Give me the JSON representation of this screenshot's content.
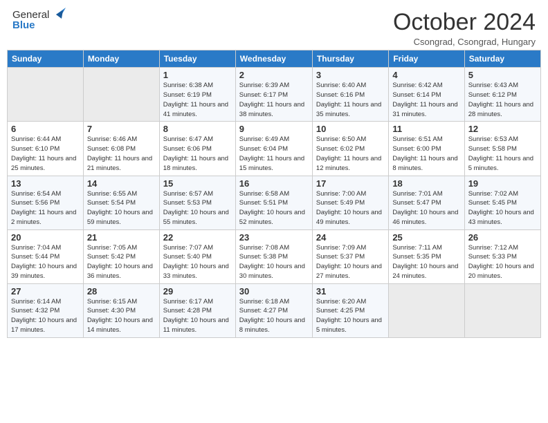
{
  "header": {
    "logo_general": "General",
    "logo_blue": "Blue",
    "month_title": "October 2024",
    "location": "Csongrad, Csongrad, Hungary"
  },
  "days_of_week": [
    "Sunday",
    "Monday",
    "Tuesday",
    "Wednesday",
    "Thursday",
    "Friday",
    "Saturday"
  ],
  "weeks": [
    [
      {
        "day": "",
        "info": ""
      },
      {
        "day": "",
        "info": ""
      },
      {
        "day": "1",
        "info": "Sunrise: 6:38 AM\nSunset: 6:19 PM\nDaylight: 11 hours and 41 minutes."
      },
      {
        "day": "2",
        "info": "Sunrise: 6:39 AM\nSunset: 6:17 PM\nDaylight: 11 hours and 38 minutes."
      },
      {
        "day": "3",
        "info": "Sunrise: 6:40 AM\nSunset: 6:16 PM\nDaylight: 11 hours and 35 minutes."
      },
      {
        "day": "4",
        "info": "Sunrise: 6:42 AM\nSunset: 6:14 PM\nDaylight: 11 hours and 31 minutes."
      },
      {
        "day": "5",
        "info": "Sunrise: 6:43 AM\nSunset: 6:12 PM\nDaylight: 11 hours and 28 minutes."
      }
    ],
    [
      {
        "day": "6",
        "info": "Sunrise: 6:44 AM\nSunset: 6:10 PM\nDaylight: 11 hours and 25 minutes."
      },
      {
        "day": "7",
        "info": "Sunrise: 6:46 AM\nSunset: 6:08 PM\nDaylight: 11 hours and 21 minutes."
      },
      {
        "day": "8",
        "info": "Sunrise: 6:47 AM\nSunset: 6:06 PM\nDaylight: 11 hours and 18 minutes."
      },
      {
        "day": "9",
        "info": "Sunrise: 6:49 AM\nSunset: 6:04 PM\nDaylight: 11 hours and 15 minutes."
      },
      {
        "day": "10",
        "info": "Sunrise: 6:50 AM\nSunset: 6:02 PM\nDaylight: 11 hours and 12 minutes."
      },
      {
        "day": "11",
        "info": "Sunrise: 6:51 AM\nSunset: 6:00 PM\nDaylight: 11 hours and 8 minutes."
      },
      {
        "day": "12",
        "info": "Sunrise: 6:53 AM\nSunset: 5:58 PM\nDaylight: 11 hours and 5 minutes."
      }
    ],
    [
      {
        "day": "13",
        "info": "Sunrise: 6:54 AM\nSunset: 5:56 PM\nDaylight: 11 hours and 2 minutes."
      },
      {
        "day": "14",
        "info": "Sunrise: 6:55 AM\nSunset: 5:54 PM\nDaylight: 10 hours and 59 minutes."
      },
      {
        "day": "15",
        "info": "Sunrise: 6:57 AM\nSunset: 5:53 PM\nDaylight: 10 hours and 55 minutes."
      },
      {
        "day": "16",
        "info": "Sunrise: 6:58 AM\nSunset: 5:51 PM\nDaylight: 10 hours and 52 minutes."
      },
      {
        "day": "17",
        "info": "Sunrise: 7:00 AM\nSunset: 5:49 PM\nDaylight: 10 hours and 49 minutes."
      },
      {
        "day": "18",
        "info": "Sunrise: 7:01 AM\nSunset: 5:47 PM\nDaylight: 10 hours and 46 minutes."
      },
      {
        "day": "19",
        "info": "Sunrise: 7:02 AM\nSunset: 5:45 PM\nDaylight: 10 hours and 43 minutes."
      }
    ],
    [
      {
        "day": "20",
        "info": "Sunrise: 7:04 AM\nSunset: 5:44 PM\nDaylight: 10 hours and 39 minutes."
      },
      {
        "day": "21",
        "info": "Sunrise: 7:05 AM\nSunset: 5:42 PM\nDaylight: 10 hours and 36 minutes."
      },
      {
        "day": "22",
        "info": "Sunrise: 7:07 AM\nSunset: 5:40 PM\nDaylight: 10 hours and 33 minutes."
      },
      {
        "day": "23",
        "info": "Sunrise: 7:08 AM\nSunset: 5:38 PM\nDaylight: 10 hours and 30 minutes."
      },
      {
        "day": "24",
        "info": "Sunrise: 7:09 AM\nSunset: 5:37 PM\nDaylight: 10 hours and 27 minutes."
      },
      {
        "day": "25",
        "info": "Sunrise: 7:11 AM\nSunset: 5:35 PM\nDaylight: 10 hours and 24 minutes."
      },
      {
        "day": "26",
        "info": "Sunrise: 7:12 AM\nSunset: 5:33 PM\nDaylight: 10 hours and 20 minutes."
      }
    ],
    [
      {
        "day": "27",
        "info": "Sunrise: 6:14 AM\nSunset: 4:32 PM\nDaylight: 10 hours and 17 minutes."
      },
      {
        "day": "28",
        "info": "Sunrise: 6:15 AM\nSunset: 4:30 PM\nDaylight: 10 hours and 14 minutes."
      },
      {
        "day": "29",
        "info": "Sunrise: 6:17 AM\nSunset: 4:28 PM\nDaylight: 10 hours and 11 minutes."
      },
      {
        "day": "30",
        "info": "Sunrise: 6:18 AM\nSunset: 4:27 PM\nDaylight: 10 hours and 8 minutes."
      },
      {
        "day": "31",
        "info": "Sunrise: 6:20 AM\nSunset: 4:25 PM\nDaylight: 10 hours and 5 minutes."
      },
      {
        "day": "",
        "info": ""
      },
      {
        "day": "",
        "info": ""
      }
    ]
  ]
}
